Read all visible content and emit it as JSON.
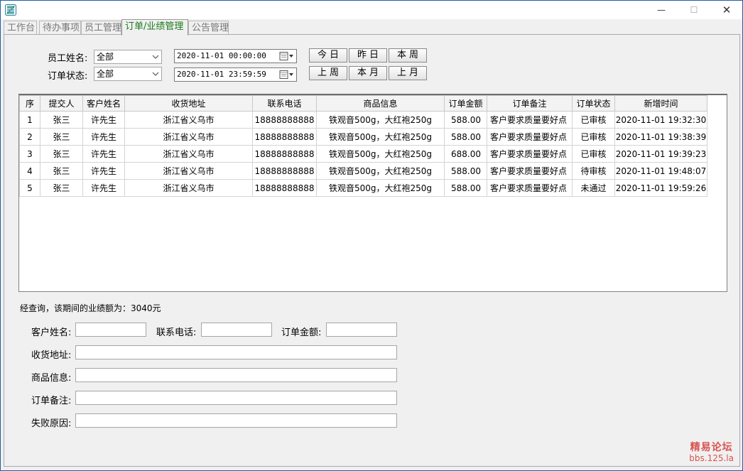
{
  "window": {
    "min_glyph": "—",
    "max_glyph": "☐",
    "close_glyph": "✕"
  },
  "tabs": [
    {
      "label": "工作台"
    },
    {
      "label": "待办事项"
    },
    {
      "label": "员工管理"
    },
    {
      "label": "订单/业绩管理",
      "active": true
    },
    {
      "label": "公告管理"
    }
  ],
  "filters": {
    "employee_label": "员工姓名:",
    "employee_value": "全部",
    "status_label": "订单状态:",
    "status_value": "全部",
    "start_datetime": "2020-11-01 00:00:00",
    "end_datetime": "2020-11-01 23:59:59"
  },
  "quick_buttons": {
    "today": "今日",
    "yesterday": "昨日",
    "this_week": "本周",
    "last_week": "上周",
    "this_month": "本月",
    "last_month": "上月"
  },
  "table": {
    "headers": [
      "序",
      "提交人",
      "客户姓名",
      "收货地址",
      "联系电话",
      "商品信息",
      "订单金额",
      "订单备注",
      "订单状态",
      "新增时间"
    ],
    "rows": [
      [
        "1",
        "张三",
        "许先生",
        "浙江省义乌市",
        "18888888888",
        "铁观音500g，大红袍250g",
        "588.00",
        "客户要求质量要好点",
        "已审核",
        "2020-11-01 19:32:30"
      ],
      [
        "2",
        "张三",
        "许先生",
        "浙江省义乌市",
        "18888888888",
        "铁观音500g，大红袍250g",
        "588.00",
        "客户要求质量要好点",
        "已审核",
        "2020-11-01 19:38:39"
      ],
      [
        "3",
        "张三",
        "许先生",
        "浙江省义乌市",
        "18888888888",
        "铁观音500g，大红袍250g",
        "688.00",
        "客户要求质量要好点",
        "已审核",
        "2020-11-01 19:39:23"
      ],
      [
        "4",
        "张三",
        "许先生",
        "浙江省义乌市",
        "18888888888",
        "铁观音500g，大红袍250g",
        "588.00",
        "客户要求质量要好点",
        "待审核",
        "2020-11-01 19:48:07"
      ],
      [
        "5",
        "张三",
        "许先生",
        "浙江省义乌市",
        "18888888888",
        "铁观音500g，大红袍250g",
        "588.00",
        "客户要求质量要好点",
        "未通过",
        "2020-11-01 19:59:26"
      ]
    ]
  },
  "summary": "经查询，该期间的业绩额为：3040元",
  "form": {
    "customer_name_label": "客户姓名:",
    "phone_label": "联系电话:",
    "amount_label": "订单金额:",
    "address_label": "收货地址:",
    "goods_label": "商品信息:",
    "remark_label": "订单备注:",
    "fail_reason_label": "失败原因:"
  },
  "watermark": {
    "line1": "精易论坛",
    "line2": "bbs.125.la"
  },
  "colors": {
    "active_tab": "#1a7a1a",
    "watermark": "#d9534f",
    "window_border": "#1e5fa8"
  }
}
